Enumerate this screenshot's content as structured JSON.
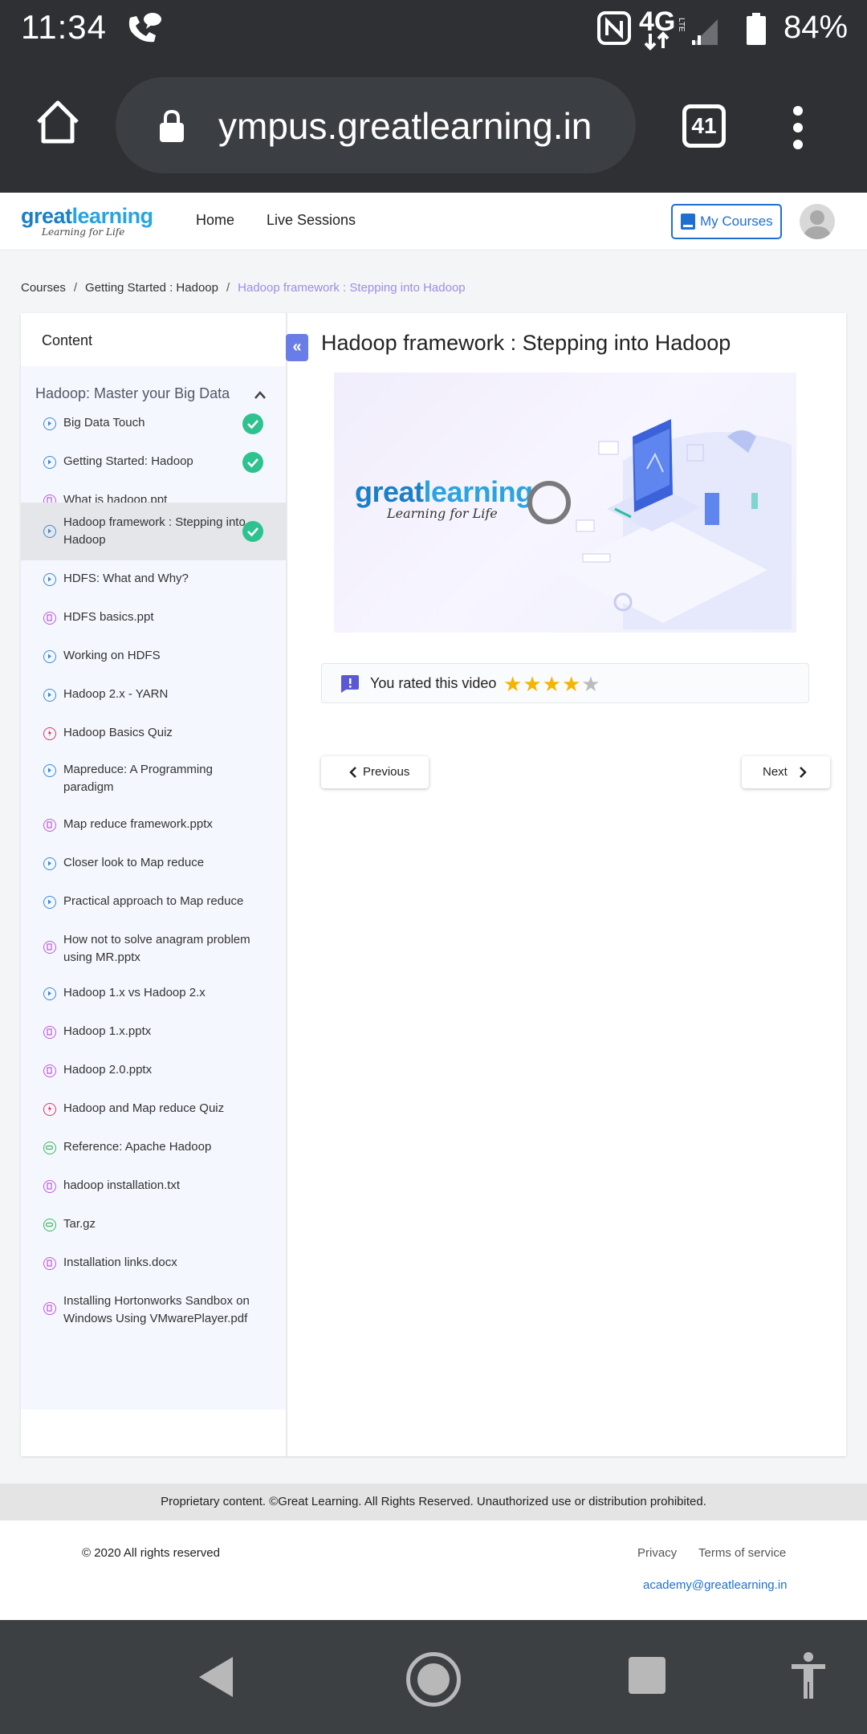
{
  "status_bar": {
    "time": "11:34",
    "network": "4G",
    "battery": "84%"
  },
  "browser": {
    "url": "ympus.greatlearning.in",
    "tab_count": "41"
  },
  "site": {
    "logo_main": "great",
    "logo_accent": "learning",
    "logo_tagline": "Learning for Life",
    "nav": {
      "home": "Home",
      "live": "Live Sessions"
    },
    "my_courses": "My Courses"
  },
  "breadcrumb": {
    "items": [
      "Courses",
      "Getting Started : Hadoop"
    ],
    "current": "Hadoop framework : Stepping into Hadoop",
    "separator": "/"
  },
  "sidebar": {
    "header": "Content",
    "module_title": "Hadoop: Master your Big Data",
    "items": [
      {
        "label": "Big Data Touch",
        "type": "video",
        "done": true
      },
      {
        "label": "Getting Started: Hadoop",
        "type": "video",
        "done": true
      },
      {
        "label": "What is hadoop.ppt",
        "type": "file",
        "done": false
      },
      {
        "label": "Hadoop framework : Stepping into Hadoop",
        "type": "video",
        "done": true,
        "active": true
      },
      {
        "label": "HDFS: What and Why?",
        "type": "video",
        "done": false
      },
      {
        "label": "HDFS basics.ppt",
        "type": "file",
        "done": false
      },
      {
        "label": "Working on HDFS",
        "type": "video",
        "done": false
      },
      {
        "label": "Hadoop 2.x - YARN",
        "type": "video",
        "done": false
      },
      {
        "label": "Hadoop Basics Quiz",
        "type": "quiz",
        "done": false
      },
      {
        "label": "Mapreduce: A Programming paradigm",
        "type": "video",
        "done": false
      },
      {
        "label": "Map reduce framework.pptx",
        "type": "file",
        "done": false
      },
      {
        "label": "Closer look to Map reduce",
        "type": "video",
        "done": false
      },
      {
        "label": "Practical approach to Map reduce",
        "type": "video",
        "done": false
      },
      {
        "label": "How not to solve anagram problem using MR.pptx",
        "type": "file",
        "done": false
      },
      {
        "label": "Hadoop 1.x vs Hadoop 2.x",
        "type": "video",
        "done": false
      },
      {
        "label": "Hadoop 1.x.pptx",
        "type": "file",
        "done": false
      },
      {
        "label": "Hadoop 2.0.pptx",
        "type": "file",
        "done": false
      },
      {
        "label": "Hadoop and Map reduce Quiz",
        "type": "quiz",
        "done": false
      },
      {
        "label": "Reference: Apache Hadoop",
        "type": "link",
        "done": false
      },
      {
        "label": "hadoop installation.txt",
        "type": "file",
        "done": false
      },
      {
        "label": "Tar.gz",
        "type": "link",
        "done": false
      },
      {
        "label": "Installation links.docx",
        "type": "file",
        "done": false
      },
      {
        "label": "Installing Hortonworks Sandbox on Windows Using VMwarePlayer.pdf",
        "type": "file",
        "done": false
      }
    ]
  },
  "main": {
    "title": "Hadoop framework : Stepping into Hadoop",
    "thumb_logo_main": "great",
    "thumb_logo_accent": "learning",
    "thumb_tagline": "Learning for Life",
    "rating_text": "You rated this video",
    "rating": 4,
    "rating_max": 5,
    "prev_label": "Previous",
    "next_label": "Next"
  },
  "footer": {
    "notice": "Proprietary content. ©Great Learning. All Rights Reserved. Unauthorized use or distribution prohibited.",
    "copyright": "© 2020 All rights reserved",
    "privacy": "Privacy",
    "terms": "Terms of service",
    "email": "academy@greatlearning.in"
  },
  "colors": {
    "accent": "#1f6fd1",
    "check": "#2ec28e",
    "star": "#f5b400",
    "breadcrumb_current": "#a08ce6",
    "icon_video": "#3a8bd6",
    "icon_file": "#c05ad6",
    "icon_quiz": "#e0365e",
    "icon_link": "#3bb85f"
  }
}
